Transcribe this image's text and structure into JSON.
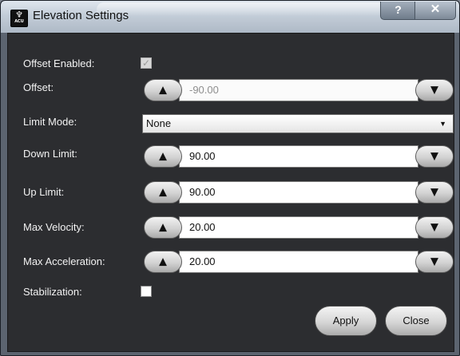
{
  "window": {
    "title": "Elevation Settings",
    "help_label": "?",
    "close_label": "✕",
    "app_icon_glyph": "♆",
    "app_icon_text": "ACU"
  },
  "offset_enabled": {
    "label": "Offset Enabled:",
    "checked": true,
    "enabled": false,
    "check_mark": "✓"
  },
  "offset": {
    "label": "Offset:",
    "value": "-90.00",
    "enabled": false
  },
  "limit_mode": {
    "label": "Limit Mode:",
    "value": "None"
  },
  "down_limit": {
    "label": "Down Limit:",
    "value": "90.00"
  },
  "up_limit": {
    "label": "Up Limit:",
    "value": "90.00"
  },
  "max_velocity": {
    "label": "Max Velocity:",
    "value": "20.00"
  },
  "max_acceleration": {
    "label": "Max Acceleration:",
    "value": "20.00"
  },
  "stabilization": {
    "label": "Stabilization:",
    "checked": false
  },
  "buttons": {
    "apply": "Apply",
    "close": "Close"
  },
  "icons": {
    "up": "▲",
    "down": "▼",
    "dropdown": "▼"
  }
}
